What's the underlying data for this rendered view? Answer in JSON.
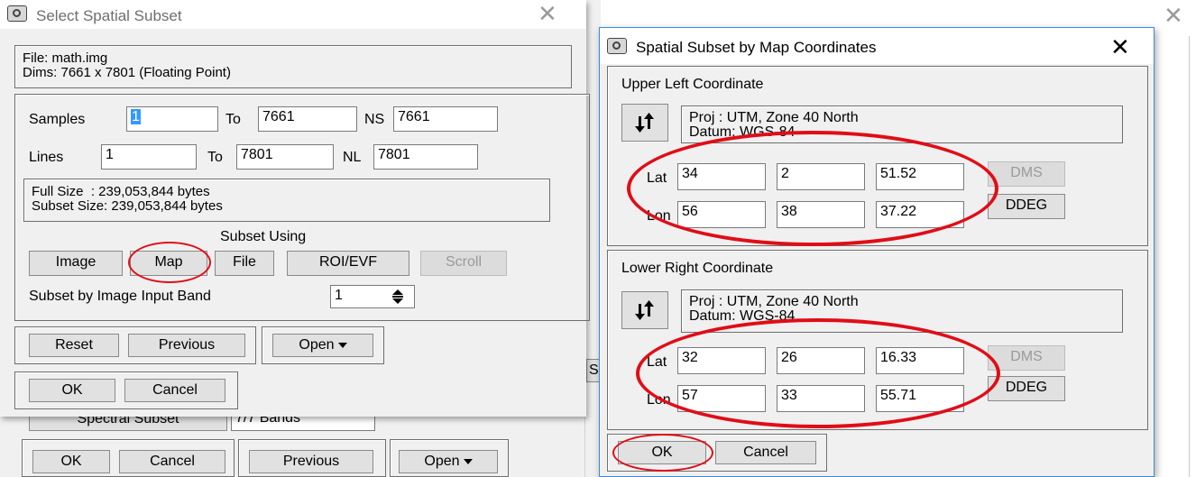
{
  "colors": {
    "annotation": "#e00d17",
    "selection": "#3399ff",
    "window_bg": "#f0f0f0"
  },
  "background_window": {
    "spectral_subset_button": "Spectral Subset",
    "bands_label": "7/7 Bands",
    "partial_label": "S",
    "ok": "OK",
    "cancel": "Cancel",
    "previous": "Previous",
    "open": "Open"
  },
  "left_dialog": {
    "title": "Select Spatial Subset",
    "file_info": {
      "file": "File: math.img",
      "dims": "Dims: 7661 x 7801 (Floating Point)"
    },
    "samples": {
      "label": "Samples",
      "value": "1",
      "to_label": "To",
      "to_value": "7661",
      "ns_label": "NS",
      "ns_value": "7661"
    },
    "lines": {
      "label": "Lines",
      "value": "1",
      "to_label": "To",
      "to_value": "7801",
      "nl_label": "NL",
      "nl_value": "7801"
    },
    "size_info": {
      "full": "Full Size  : 239,053,844 bytes",
      "subset": "Subset Size: 239,053,844 bytes"
    },
    "subset_using": {
      "label": "Subset Using",
      "buttons": [
        "Image",
        "Map",
        "File",
        "ROI/EVF",
        "Scroll"
      ]
    },
    "band": {
      "label": "Subset by Image Input Band",
      "value": "1"
    },
    "reset": "Reset",
    "previous": "Previous",
    "open": "Open",
    "ok": "OK",
    "cancel": "Cancel"
  },
  "right_dialog": {
    "title": "Spatial Subset by Map Coordinates",
    "upper_left": {
      "heading": "Upper Left Coordinate",
      "proj": "Proj : UTM, Zone 40 North",
      "datum": "Datum: WGS-84",
      "lat_label": "Lat",
      "lat": [
        "34",
        "2",
        "51.52"
      ],
      "lon_label": "Lon",
      "lon": [
        "56",
        "38",
        "37.22"
      ],
      "dms": "DMS",
      "ddeg": "DDEG"
    },
    "lower_right": {
      "heading": "Lower Right Coordinate",
      "proj": "Proj : UTM, Zone 40 North",
      "datum": "Datum: WGS-84",
      "lat_label": "Lat",
      "lat": [
        "32",
        "26",
        "16.33"
      ],
      "lon_label": "Lon",
      "lon": [
        "57",
        "33",
        "55.71"
      ],
      "dms": "DMS",
      "ddeg": "DDEG"
    },
    "ok": "OK",
    "cancel": "Cancel"
  },
  "close_glyph": "✕"
}
